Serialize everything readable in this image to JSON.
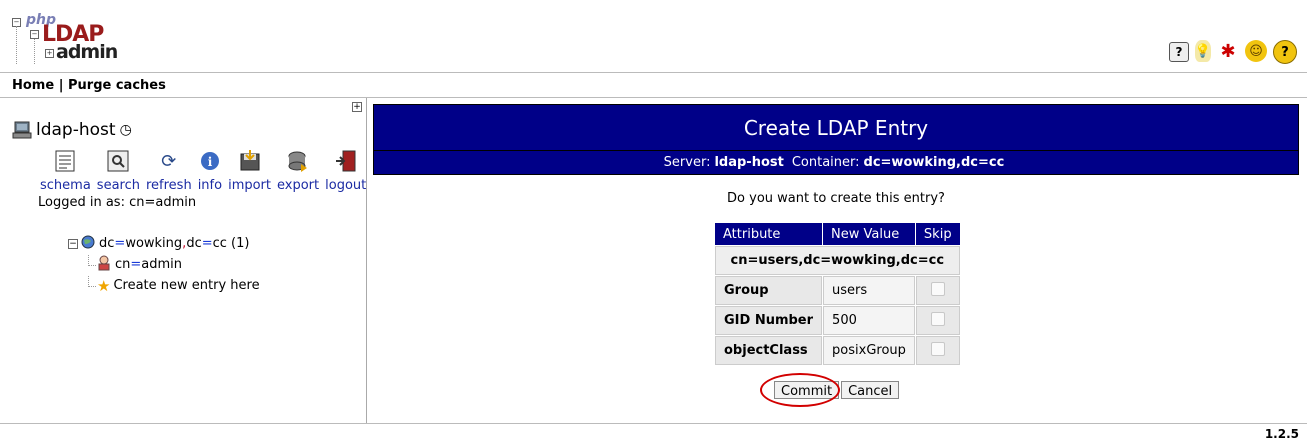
{
  "header": {
    "logo": {
      "php": "php",
      "ldap": "LDAP",
      "admin": "admin"
    },
    "icons": [
      "help-icon",
      "lightbulb-icon",
      "bug-icon",
      "smiley-icon",
      "question-icon"
    ]
  },
  "menu": {
    "home": "Home",
    "sep": " | ",
    "purge": "Purge caches"
  },
  "left": {
    "server_name": "ldap-host",
    "tools": [
      {
        "label": "schema",
        "icon": "schema-icon"
      },
      {
        "label": "search",
        "icon": "search-icon"
      },
      {
        "label": "refresh",
        "icon": "refresh-icon"
      },
      {
        "label": "info",
        "icon": "info-icon"
      },
      {
        "label": "import",
        "icon": "import-icon"
      },
      {
        "label": "export",
        "icon": "export-icon"
      },
      {
        "label": "logout",
        "icon": "logout-icon"
      }
    ],
    "logged_in": "Logged in as: cn=admin",
    "tree": {
      "root_dc1": "dc",
      "root_eq1": "=",
      "root_v1": "wowking",
      "root_comma": ",",
      "root_dc2": "dc",
      "root_eq2": "=",
      "root_v2": "cc",
      "root_count": " (1)",
      "child_cn": "cn",
      "child_eq": "=",
      "child_v": "admin",
      "create_new": "Create new entry here"
    }
  },
  "main": {
    "title": "Create LDAP Entry",
    "server_label": "Server:",
    "server_value": "ldap-host",
    "container_label": "Container:",
    "container_value": "dc=wowking,dc=cc",
    "question": "Do you want to create this entry?",
    "table": {
      "headers": [
        "Attribute",
        "New Value",
        "Skip"
      ],
      "dn": "cn=users,dc=wowking,dc=cc",
      "rows": [
        {
          "attribute": "Group",
          "value": "users"
        },
        {
          "attribute": "GID Number",
          "value": "500"
        },
        {
          "attribute": "objectClass",
          "value": "posixGroup"
        }
      ]
    },
    "commit_label": "Commit",
    "cancel_label": "Cancel"
  },
  "footer": {
    "version": "1.2.5"
  },
  "colors": {
    "header_bg": "#000088",
    "link": "#1b2ba3",
    "highlight_ring": "#d20000"
  }
}
